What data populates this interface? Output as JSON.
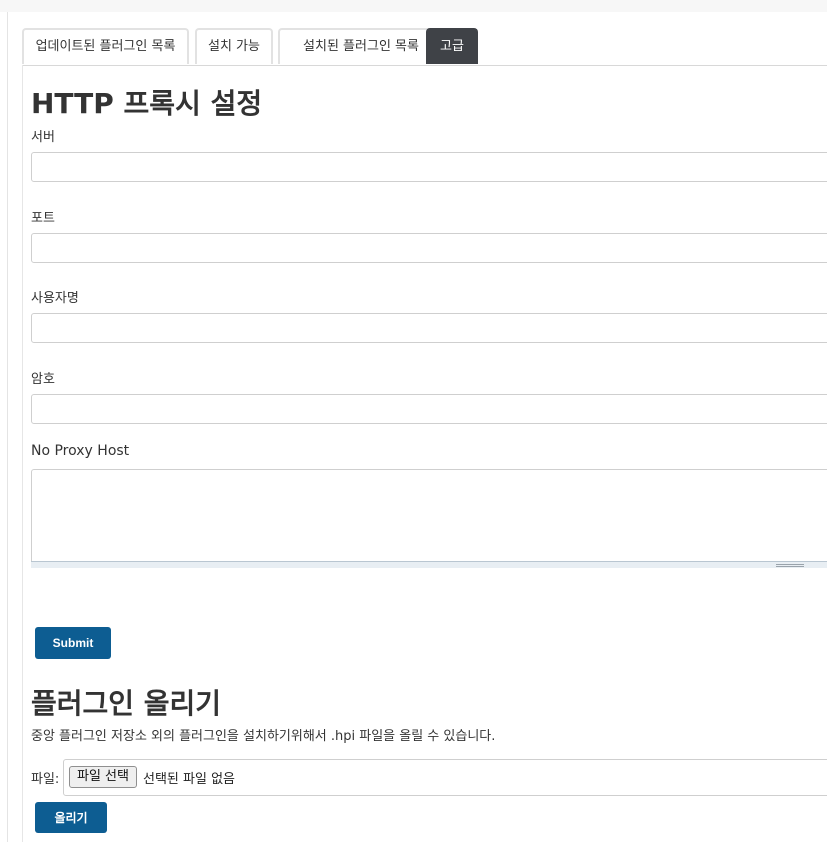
{
  "tabs": [
    {
      "label": "업데이트된 플러그인 목록",
      "active": false
    },
    {
      "label": "설치 가능",
      "active": false
    },
    {
      "label": "설치된 플러그인 목록",
      "active": false
    },
    {
      "label": "고급",
      "active": true
    }
  ],
  "proxy": {
    "title": "HTTP 프록시 설정",
    "server_label": "서버",
    "server_value": "",
    "port_label": "포트",
    "port_value": "",
    "username_label": "사용자명",
    "username_value": "",
    "password_label": "암호",
    "password_value": "",
    "no_proxy_label": "No Proxy Host",
    "no_proxy_value": "",
    "submit_label": "Submit"
  },
  "upload": {
    "title": "플러그인 올리기",
    "description": "중앙 플러그인 저장소 외의 플러그인을 설치하기위해서 .hpi 파일을 올릴 수 있습니다.",
    "file_label": "파일:",
    "choose_button": "파일 선택",
    "no_file_text": "선택된 파일 없음",
    "upload_button": "올리기"
  },
  "colors": {
    "primary_button": "#0d5d92",
    "active_tab": "#3f4247"
  }
}
